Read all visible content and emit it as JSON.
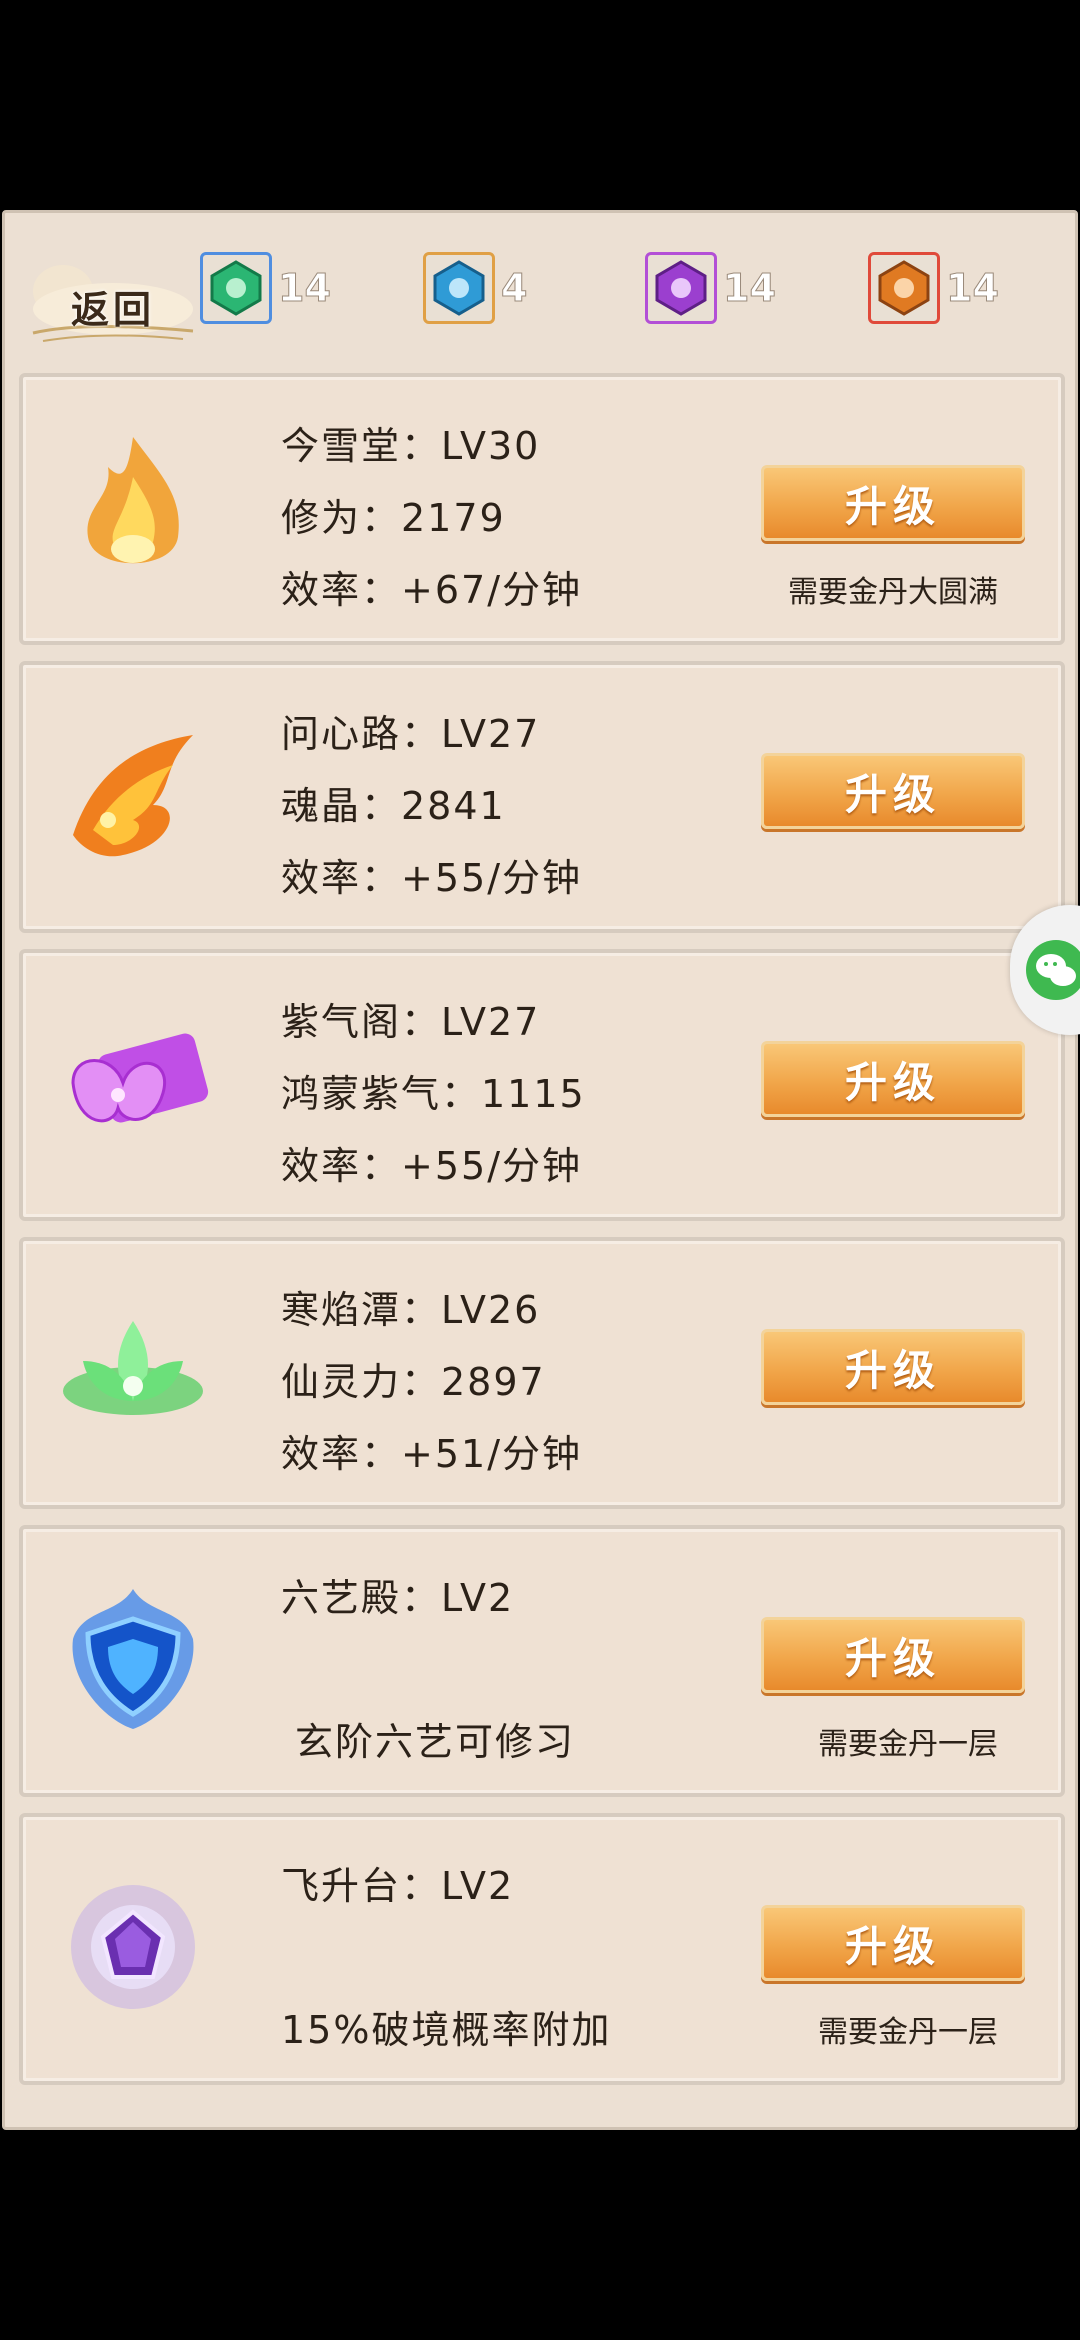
{
  "header": {
    "back_label": "返回",
    "resources": [
      {
        "icon": "green-gem-icon",
        "count": "14",
        "color": "#2bb673",
        "border": "#4f8ee0"
      },
      {
        "icon": "blue-gem-icon",
        "count": "4",
        "color": "#2f9bd6",
        "border": "#e0a045"
      },
      {
        "icon": "purple-gem-icon",
        "count": "14",
        "color": "#9b3fcf",
        "border": "#b34fd6"
      },
      {
        "icon": "orange-gem-icon",
        "count": "14",
        "color": "#e07a22",
        "border": "#e04a3a"
      }
    ]
  },
  "buildings": [
    {
      "icon": "golden-flame-icon",
      "name_line": "今雪堂：LV30",
      "line2": "修为：2179",
      "line3": "效率：+67/分钟",
      "button": "升级",
      "requirement": "需要金丹大圆满"
    },
    {
      "icon": "fire-phoenix-icon",
      "name_line": "问心路：LV27",
      "line2": "魂晶：2841",
      "line3": "效率：+55/分钟",
      "button": "升级",
      "requirement": ""
    },
    {
      "icon": "purple-butterfly-scroll-icon",
      "name_line": "紫气阁：LV27",
      "line2": "鸿蒙紫气：1115",
      "line3": "效率：+55/分钟",
      "button": "升级",
      "requirement": ""
    },
    {
      "icon": "green-lotus-icon",
      "name_line": "寒焰潭：LV26",
      "line2": "仙灵力：2897",
      "line3": "效率：+51/分钟",
      "button": "升级",
      "requirement": ""
    },
    {
      "icon": "blue-shield-icon",
      "name_line": "六艺殿：LV2",
      "line2": "",
      "line3": "玄阶六艺可修习",
      "button": "升级",
      "requirement": "需要金丹一层"
    },
    {
      "icon": "purple-crystal-icon",
      "name_line": "飞升台：LV2",
      "line2": "",
      "line3": "15%破境概率附加",
      "button": "升级",
      "requirement": "需要金丹一层"
    }
  ]
}
